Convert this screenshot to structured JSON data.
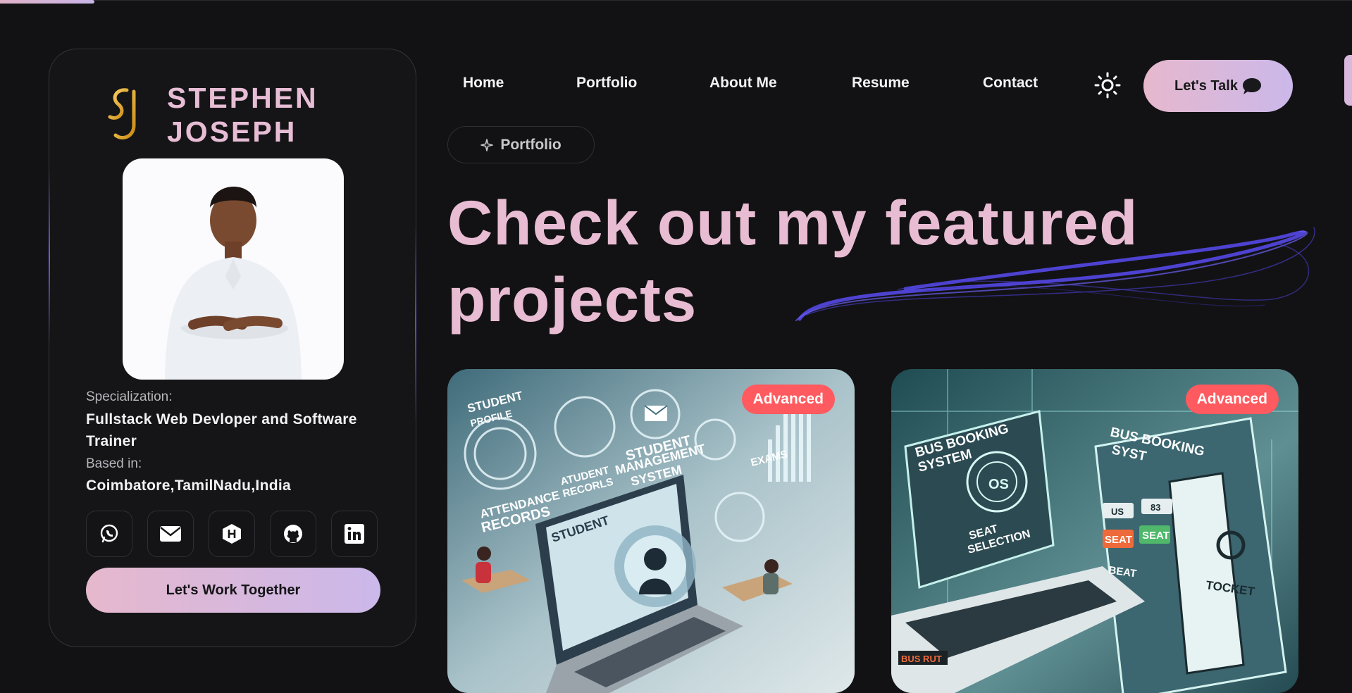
{
  "scroll_progress": 0.07,
  "profile": {
    "name_line1": "STEPHEN",
    "name_line2": "JOSEPH",
    "logo_text": "SJ",
    "specialization_label": "Specialization:",
    "specialization_value": "Fullstack Web Devloper and Software Trainer",
    "based_label": "Based in:",
    "based_value": "Coimbatore,TamilNadu,India",
    "socials": [
      "whatsapp-icon",
      "mail-icon",
      "hashnode-icon",
      "github-icon",
      "linkedin-icon"
    ],
    "cta_label": "Let's Work Together"
  },
  "nav": {
    "items": [
      "Home",
      "Portfolio",
      "About Me",
      "Resume",
      "Contact"
    ],
    "theme_icon": "sun-icon",
    "talk_label": "Let's Talk",
    "talk_icon": "chat-bubble-icon"
  },
  "section": {
    "pill_label": "Portfolio",
    "pill_icon": "sparkle-icon",
    "headline_line1": "Check out my featured",
    "headline_line2": "projects"
  },
  "projects": [
    {
      "badge": "Advanced",
      "art_labels": [
        "STUDENT",
        "PROFILE",
        "ATUDENT",
        "RECORLS",
        "STUDENT",
        "MANAGEMENT",
        "SYSTEM",
        "EXAMS",
        "ATTENDANCE",
        "RECORDS",
        "STUDENT"
      ]
    },
    {
      "badge": "Advanced",
      "art_labels": [
        "BUS BOOKING",
        "SYSTEM",
        "OS",
        "SEAT",
        "SELECTION",
        "BUS BOOKING",
        "SYST",
        "US",
        "83",
        "SEAT",
        "SEAT",
        "BEAT",
        "TOCKET",
        "BUS RUT"
      ]
    }
  ],
  "colors": {
    "background": "#121214",
    "accent_pink": "#e8bcd2",
    "accent_lavender": "#cbb8ea",
    "badge_red": "#ff5a5f",
    "swoosh_blue": "#5548e6"
  }
}
